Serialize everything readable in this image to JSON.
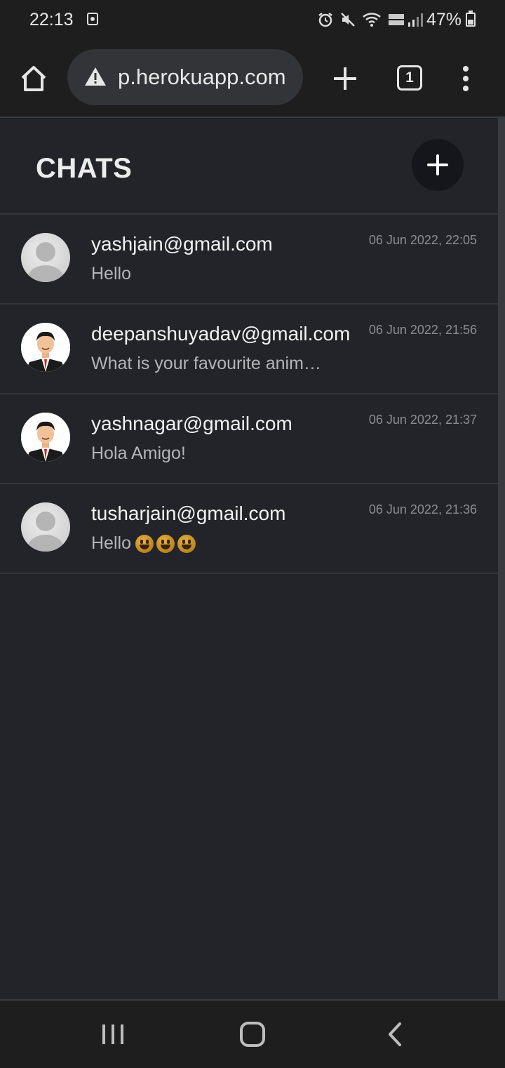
{
  "status": {
    "time": "22:13",
    "battery": "47%"
  },
  "browser": {
    "url": "p.herokuapp.com",
    "tab_count": "1"
  },
  "page": {
    "title": "CHATS"
  },
  "chats": [
    {
      "name": "yashjain@gmail.com",
      "message": "Hello",
      "time": "06 Jun 2022, 22:05",
      "avatar": "default-avatar-icon"
    },
    {
      "name": "deepanshuyadav@gmail.com",
      "message": "What is your favourite anim…",
      "time": "06 Jun 2022, 21:56",
      "avatar": "person-avatar-icon"
    },
    {
      "name": "yashnagar@gmail.com",
      "message": "Hola Amigo!",
      "time": "06 Jun 2022, 21:37",
      "avatar": "person-avatar-icon"
    },
    {
      "name": "tusharjain@gmail.com",
      "message": "Hello",
      "time": "06 Jun 2022, 21:36",
      "avatar": "default-avatar-icon"
    }
  ],
  "colors": {
    "background": "#23242a",
    "bar": "#1e1e1f",
    "accent_button": "#15161b"
  }
}
